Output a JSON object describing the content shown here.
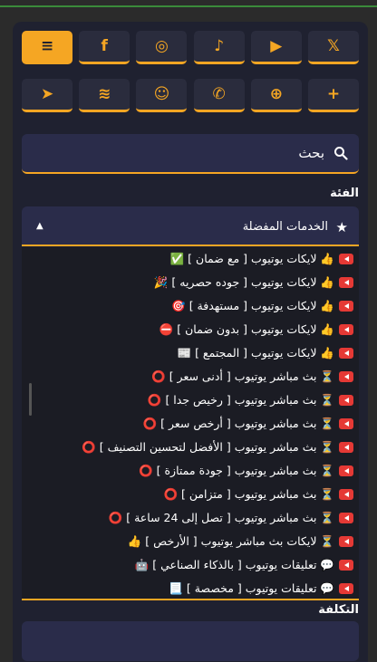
{
  "social_row_1": [
    {
      "name": "menu-icon",
      "glyph": "≡",
      "active": true
    },
    {
      "name": "facebook-icon",
      "glyph": "f",
      "active": false
    },
    {
      "name": "instagram-icon",
      "glyph": "◎",
      "active": false
    },
    {
      "name": "tiktok-icon",
      "glyph": "♪",
      "active": false
    },
    {
      "name": "youtube-icon",
      "glyph": "▶",
      "active": false
    },
    {
      "name": "x-icon",
      "glyph": "𝕏",
      "active": false
    }
  ],
  "social_row_2": [
    {
      "name": "telegram-icon",
      "glyph": "➤"
    },
    {
      "name": "spotify-icon",
      "glyph": "≋"
    },
    {
      "name": "snapchat-icon",
      "glyph": "☺"
    },
    {
      "name": "whatsapp-icon",
      "glyph": "✆"
    },
    {
      "name": "globe-icon",
      "glyph": "⊕"
    },
    {
      "name": "plus-icon",
      "glyph": "+"
    }
  ],
  "search": {
    "label": "بحث"
  },
  "category": {
    "label": "الفئة",
    "selected": "الخدمات المفضلة",
    "caret": "▲",
    "star": "★"
  },
  "options": [
    {
      "text": "👍 لايكات يوتيوب [ مع ضمان ] ✅"
    },
    {
      "text": "👍 لايكات يوتيوب [ جوده حصريه ] 🎉"
    },
    {
      "text": "👍 لايكات يوتيوب [ مستهدفة ] 🎯"
    },
    {
      "text": "👍 لايكات يوتيوب [ بدون ضمان ] ⛔"
    },
    {
      "text": "👍 لايكات يوتيوب [ المجتمع ] 📰"
    },
    {
      "text": "⏳ بث مباشر يوتيوب [ أدنى سعر ] ⭕"
    },
    {
      "text": "⏳ بث مباشر يوتيوب [ رخيص جدا ] ⭕"
    },
    {
      "text": "⏳ بث مباشر يوتيوب [ أرخص سعر ] ⭕"
    },
    {
      "text": "⏳ بث مباشر يوتيوب [ الأفضل لتحسين التصنيف ] ⭕"
    },
    {
      "text": "⏳ بث مباشر يوتيوب [ جودة ممتازة ] ⭕"
    },
    {
      "text": "⏳ بث مباشر يوتيوب [ متزامن ] ⭕"
    },
    {
      "text": "⏳ بث مباشر يوتيوب [ تصل إلى 24 ساعة ] ⭕"
    },
    {
      "text": "⏳ لايكات بث مباشر يوتيوب [ الأرخص ] 👍"
    },
    {
      "text": "💬 تعليقات يوتيوب [ بالذكاء الصناعي ] 🤖"
    },
    {
      "text": "💬 تعليقات يوتيوب [ مخصصة ] 📃"
    }
  ],
  "cost": {
    "label": "التكلفة"
  },
  "colors": {
    "accent": "#f5a623",
    "panel": "#1f2130",
    "field": "#2a2c4a",
    "youtube": "#e53935"
  }
}
